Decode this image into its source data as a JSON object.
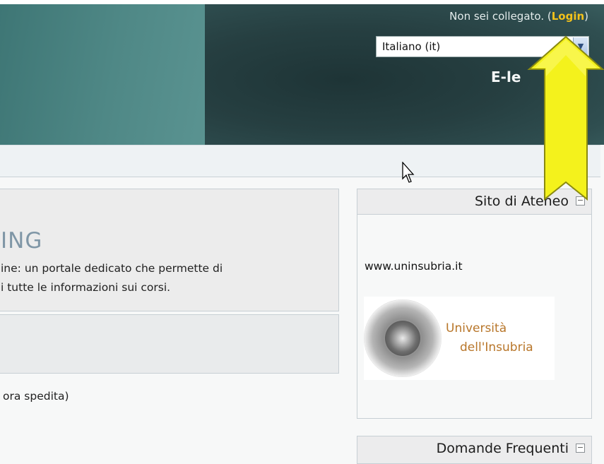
{
  "header": {
    "login_prefix": "Non sei collegato. (",
    "login_link": "Login",
    "login_suffix": ")",
    "language_selected": "Italiano (it)",
    "site_name_partial": "E-le"
  },
  "main": {
    "welcome_title_partial": "ING",
    "welcome_line1": "ine: un portale dedicato che permette di",
    "welcome_line2": "i tutte le informazioni sui corsi.",
    "news_text": "ora spedita)"
  },
  "sidebar": {
    "ateneo_block": {
      "title": "Sito di Ateneo",
      "url": "www.uninsubria.it",
      "logo_line1": "Università",
      "logo_line2": "dell'Insubria"
    },
    "faq_block": {
      "title": "Domande Frequenti"
    }
  },
  "overlay": {
    "arrow_color": "#f4f21c",
    "arrow_outline": "#8a8a10"
  },
  "colors": {
    "login_link": "#f3c21b",
    "header_teal": "#4f8586",
    "header_dark": "#253e40",
    "logo_text": "#b8762a"
  }
}
